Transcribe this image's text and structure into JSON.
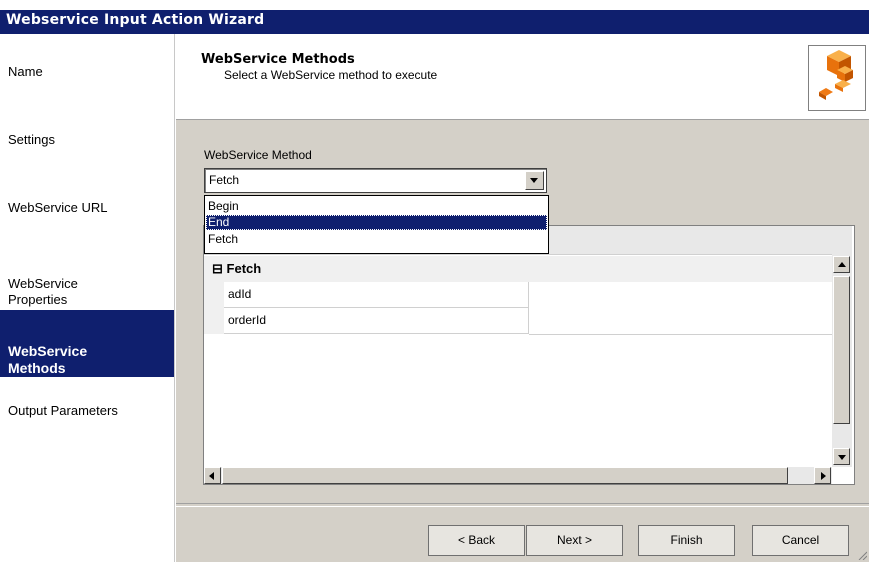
{
  "window": {
    "title": "Webservice Input Action Wizard"
  },
  "nav": {
    "items": [
      {
        "label": "Name"
      },
      {
        "label": "Settings"
      },
      {
        "label": "WebService URL"
      },
      {
        "label": "WebService\nProperties"
      },
      {
        "label": "WebService\nMethods",
        "active": true
      },
      {
        "label": "Output Parameters"
      }
    ]
  },
  "header": {
    "title": "WebService Methods",
    "subtitle": "Select a WebService method to execute",
    "logo_icon": "cubes-logo-icon"
  },
  "method": {
    "label": "WebService Method",
    "selected_value": "Fetch",
    "options": [
      "Begin",
      "End",
      "Fetch"
    ],
    "highlighted_option": "End"
  },
  "grid": {
    "category": {
      "expander": "⊟",
      "label": "Fetch"
    },
    "rows": [
      {
        "name": "adId",
        "value": ""
      },
      {
        "name": "orderId",
        "value": ""
      }
    ]
  },
  "buttons": {
    "back": "< Back",
    "next": "Next >",
    "finish": "Finish",
    "cancel": "Cancel"
  },
  "colors": {
    "titlebar": "#0f1f6e",
    "active_nav": "#0f1f6e",
    "panel_gray": "#d4d0c8"
  }
}
